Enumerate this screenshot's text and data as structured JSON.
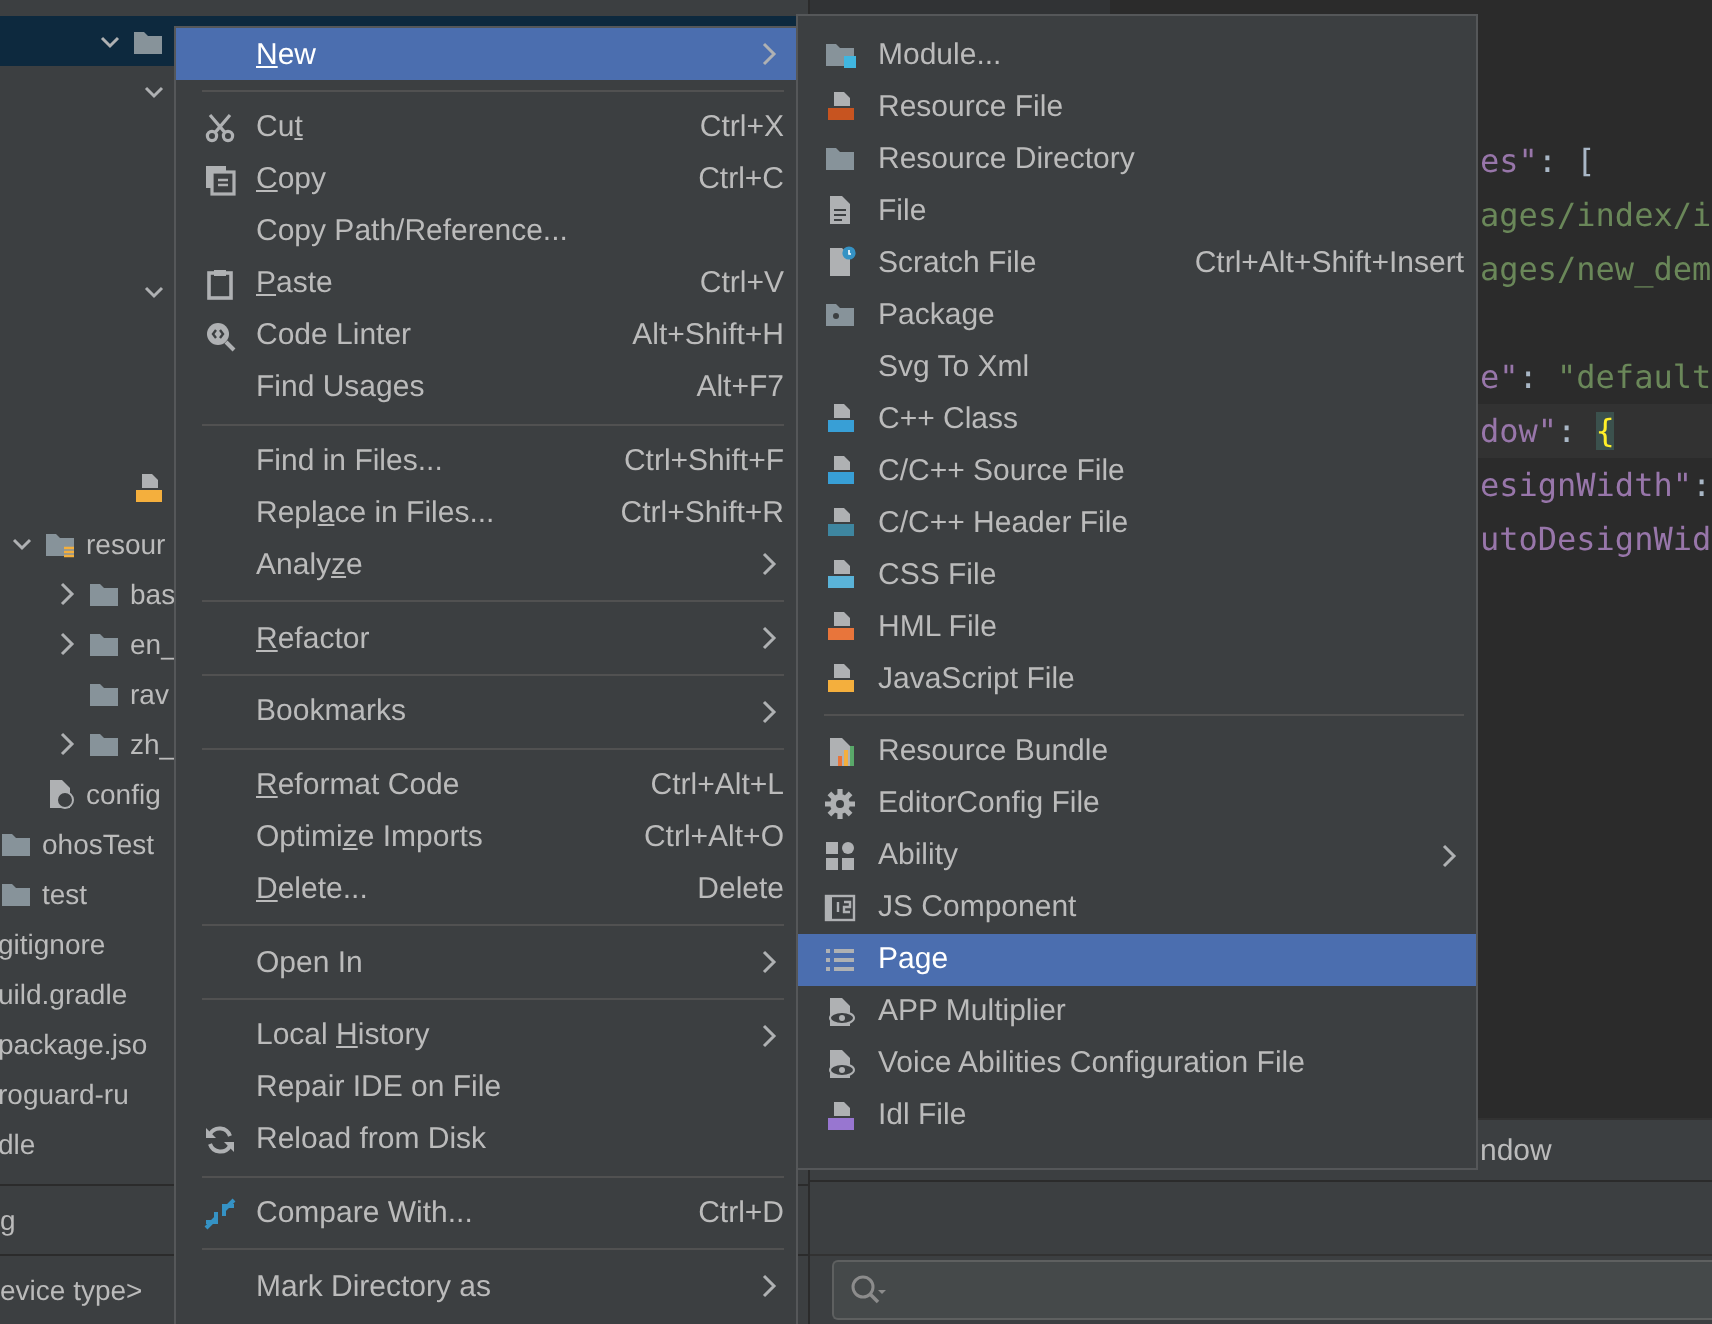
{
  "project_tree": [
    {
      "kind": "folder",
      "selected": true,
      "expanded": true,
      "children": [
        {
          "selected": false,
          "expanded": true
        },
        {
          "selected": false,
          "expanded": true
        }
      ]
    },
    {
      "kind": "script",
      "selected": false
    },
    {
      "kind": "resources",
      "label": "resour",
      "selected": false,
      "expanded": true,
      "children": [
        {
          "kind": "folder",
          "label": "bas",
          "selected": false,
          "expanded": false
        },
        {
          "kind": "folder",
          "label": "en_",
          "selected": false,
          "expanded": false
        },
        {
          "kind": "folder",
          "label": "rav",
          "selected": false
        },
        {
          "kind": "folder",
          "label": "zh_",
          "selected": false,
          "expanded": false
        }
      ]
    },
    {
      "kind": "config",
      "label": "config",
      "selected": false
    },
    {
      "kind": "folder",
      "label": "ohosTest",
      "selected": false
    },
    {
      "kind": "folder",
      "label": "test",
      "selected": false
    },
    {
      "kind": "file",
      "label": "gitignore",
      "selected": false
    },
    {
      "kind": "file",
      "label": "uild.gradle",
      "selected": false
    },
    {
      "kind": "file",
      "label": "package.jso",
      "selected": false
    },
    {
      "kind": "file",
      "label": "roguard-ru",
      "selected": false
    },
    {
      "kind": "file",
      "label": "dle",
      "selected": false
    }
  ],
  "left_panel_tab": "g",
  "device_type_field": "evice type>",
  "editor": {
    "lines": [
      {
        "kind": "blank",
        "current": false
      },
      {
        "kind": "blank",
        "current": false
      },
      {
        "kind": "code",
        "current": false,
        "segments": [
          {
            "text": "es\"",
            "kind": "key"
          },
          {
            "text": ": [",
            "kind": "punct"
          }
        ]
      },
      {
        "kind": "code",
        "current": false,
        "segments": [
          {
            "text": "ages/index/i",
            "kind": "string"
          }
        ]
      },
      {
        "kind": "code",
        "current": false,
        "segments": [
          {
            "text": "ages/new_dem",
            "kind": "string"
          }
        ]
      },
      {
        "kind": "blank",
        "current": false
      },
      {
        "kind": "code",
        "current": false,
        "segments": [
          {
            "text": "e\"",
            "kind": "key"
          },
          {
            "text": ": ",
            "kind": "punct"
          },
          {
            "text": "\"default",
            "kind": "string"
          }
        ]
      },
      {
        "kind": "code",
        "current": true,
        "segments": [
          {
            "text": "dow\"",
            "kind": "key"
          },
          {
            "text": ": ",
            "kind": "punct"
          },
          {
            "text": "{",
            "kind": "brace"
          }
        ]
      },
      {
        "kind": "code",
        "current": false,
        "segments": [
          {
            "text": "esignWidth\"",
            "kind": "key"
          },
          {
            "text": ":",
            "kind": "punct"
          }
        ]
      },
      {
        "kind": "code",
        "current": false,
        "segments": [
          {
            "text": "utoDesignWid",
            "kind": "key"
          }
        ]
      }
    ]
  },
  "bottom_tab": "ndow",
  "main_menu": {
    "items": [
      {
        "kind": "item",
        "label_parts": [
          {
            "text": "N",
            "underlined": true
          },
          {
            "text": "ew",
            "underlined": false
          }
        ],
        "submenu": true,
        "selected": true
      },
      {
        "kind": "separator"
      },
      {
        "kind": "item",
        "label_parts": [
          {
            "text": "Cu",
            "underlined": false
          },
          {
            "text": "t",
            "underlined": true
          }
        ],
        "shortcut": "Ctrl+X",
        "submenu": false,
        "selected": false
      },
      {
        "kind": "item",
        "label_parts": [
          {
            "text": "C",
            "underlined": true
          },
          {
            "text": "opy",
            "underlined": false
          }
        ],
        "shortcut": "Ctrl+C",
        "submenu": false,
        "selected": false
      },
      {
        "kind": "item",
        "label": "Copy Path/Reference...",
        "submenu": false,
        "selected": false
      },
      {
        "kind": "item",
        "label_parts": [
          {
            "text": "P",
            "underlined": true
          },
          {
            "text": "aste",
            "underlined": false
          }
        ],
        "shortcut": "Ctrl+V",
        "submenu": false,
        "selected": false
      },
      {
        "kind": "item",
        "label": "Code Linter",
        "shortcut": "Alt+Shift+H",
        "submenu": false,
        "selected": false
      },
      {
        "kind": "item",
        "label": "Find Usages",
        "shortcut": "Alt+F7",
        "submenu": false,
        "selected": false
      },
      {
        "kind": "separator"
      },
      {
        "kind": "item",
        "label": "Find in Files...",
        "shortcut": "Ctrl+Shift+F",
        "submenu": false,
        "selected": false
      },
      {
        "kind": "item",
        "label_parts": [
          {
            "text": "Repl",
            "underlined": false
          },
          {
            "text": "a",
            "underlined": true
          },
          {
            "text": "ce in Files...",
            "underlined": false
          }
        ],
        "shortcut": "Ctrl+Shift+R",
        "submenu": false,
        "selected": false
      },
      {
        "kind": "item",
        "label_parts": [
          {
            "text": "Analy",
            "underlined": false
          },
          {
            "text": "z",
            "underlined": true
          },
          {
            "text": "e",
            "underlined": false
          }
        ],
        "submenu": true,
        "selected": false
      },
      {
        "kind": "separator"
      },
      {
        "kind": "item",
        "label_parts": [
          {
            "text": "R",
            "underlined": true
          },
          {
            "text": "efactor",
            "underlined": false
          }
        ],
        "submenu": true,
        "selected": false
      },
      {
        "kind": "separator"
      },
      {
        "kind": "item",
        "label": "Bookmarks",
        "submenu": true,
        "selected": false
      },
      {
        "kind": "separator"
      },
      {
        "kind": "item",
        "label_parts": [
          {
            "text": "R",
            "underlined": true
          },
          {
            "text": "eformat Code",
            "underlined": false
          }
        ],
        "shortcut": "Ctrl+Alt+L",
        "submenu": false,
        "selected": false
      },
      {
        "kind": "item",
        "label_parts": [
          {
            "text": "Optimi",
            "underlined": false
          },
          {
            "text": "z",
            "underlined": true
          },
          {
            "text": "e Imports",
            "underlined": false
          }
        ],
        "shortcut": "Ctrl+Alt+O",
        "submenu": false,
        "selected": false
      },
      {
        "kind": "item",
        "label_parts": [
          {
            "text": "D",
            "underlined": true
          },
          {
            "text": "elete...",
            "underlined": false
          }
        ],
        "shortcut": "Delete",
        "submenu": false,
        "selected": false
      },
      {
        "kind": "separator"
      },
      {
        "kind": "item",
        "label": "Open In",
        "submenu": true,
        "selected": false
      },
      {
        "kind": "separator"
      },
      {
        "kind": "item",
        "label_parts": [
          {
            "text": "Local ",
            "underlined": false
          },
          {
            "text": "H",
            "underlined": true
          },
          {
            "text": "istory",
            "underlined": false
          }
        ],
        "submenu": true,
        "selected": false
      },
      {
        "kind": "item",
        "label": "Repair IDE on File",
        "submenu": false,
        "selected": false
      },
      {
        "kind": "item",
        "label": "Reload from Disk",
        "submenu": false,
        "selected": false
      },
      {
        "kind": "separator"
      },
      {
        "kind": "item",
        "label": "Compare With...",
        "shortcut": "Ctrl+D",
        "submenu": false,
        "selected": false
      },
      {
        "kind": "separator"
      },
      {
        "kind": "item",
        "label": "Mark Directory as",
        "submenu": true,
        "selected": false
      }
    ]
  },
  "new_submenu": {
    "items": [
      {
        "kind": "item",
        "label": "Module...",
        "submenu": false,
        "selected": false
      },
      {
        "kind": "item",
        "label": "Resource File",
        "submenu": false,
        "selected": false
      },
      {
        "kind": "item",
        "label": "Resource Directory",
        "submenu": false,
        "selected": false
      },
      {
        "kind": "item",
        "label": "File",
        "submenu": false,
        "selected": false
      },
      {
        "kind": "item",
        "label": "Scratch File",
        "shortcut": "Ctrl+Alt+Shift+Insert",
        "submenu": false,
        "selected": false
      },
      {
        "kind": "item",
        "label": "Package",
        "submenu": false,
        "selected": false
      },
      {
        "kind": "item",
        "label": "Svg To Xml",
        "submenu": false,
        "selected": false
      },
      {
        "kind": "item",
        "label": "C++ Class",
        "submenu": false,
        "selected": false
      },
      {
        "kind": "item",
        "label": "C/C++ Source File",
        "submenu": false,
        "selected": false
      },
      {
        "kind": "item",
        "label": "C/C++ Header File",
        "submenu": false,
        "selected": false
      },
      {
        "kind": "item",
        "label": "CSS File",
        "submenu": false,
        "selected": false
      },
      {
        "kind": "item",
        "label": "HML File",
        "submenu": false,
        "selected": false
      },
      {
        "kind": "item",
        "label": "JavaScript File",
        "submenu": false,
        "selected": false
      },
      {
        "kind": "separator"
      },
      {
        "kind": "item",
        "label": "Resource Bundle",
        "submenu": false,
        "selected": false
      },
      {
        "kind": "item",
        "label": "EditorConfig File",
        "submenu": false,
        "selected": false
      },
      {
        "kind": "item",
        "label": "Ability",
        "submenu": true,
        "selected": false
      },
      {
        "kind": "item",
        "label": "JS Component",
        "submenu": false,
        "selected": false
      },
      {
        "kind": "item",
        "label": "Page",
        "submenu": false,
        "selected": true
      },
      {
        "kind": "item",
        "label": "APP Multiplier",
        "submenu": false,
        "selected": false
      },
      {
        "kind": "item",
        "label": "Voice Abilities Configuration File",
        "submenu": false,
        "selected": false
      },
      {
        "kind": "item",
        "label": "Idl File",
        "submenu": false,
        "selected": false
      }
    ]
  }
}
